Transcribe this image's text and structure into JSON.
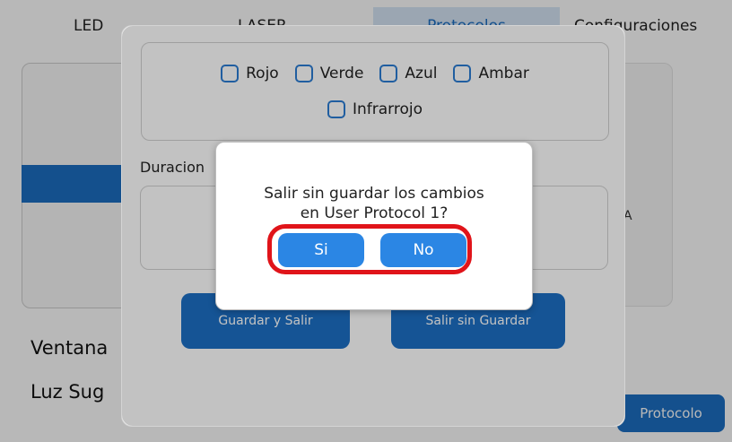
{
  "tabs": {
    "led": "LED",
    "laser": "LASER",
    "protocolos": "Protocolos",
    "configuraciones": "Configuraciones"
  },
  "background": {
    "ventana": "Ventana",
    "luz": "Luz Sug",
    "right_fragment": "A",
    "protocolo_button": "Protocolo"
  },
  "editor": {
    "colors": [
      "Rojo",
      "Verde",
      "Azul",
      "Ambar",
      "Infrarrojo"
    ],
    "duracion_label": "Duracion",
    "save_exit_label": "Guardar y Salir",
    "exit_no_save_label": "Salir sin Guardar"
  },
  "modal": {
    "line1": "Salir sin guardar los cambios",
    "line2": "en User Protocol 1?",
    "yes_label": "Si",
    "no_label": "No"
  },
  "colors": {
    "accent": "#1c6fc4",
    "modal_button": "#2b86e4",
    "highlight": "#e0141a"
  }
}
